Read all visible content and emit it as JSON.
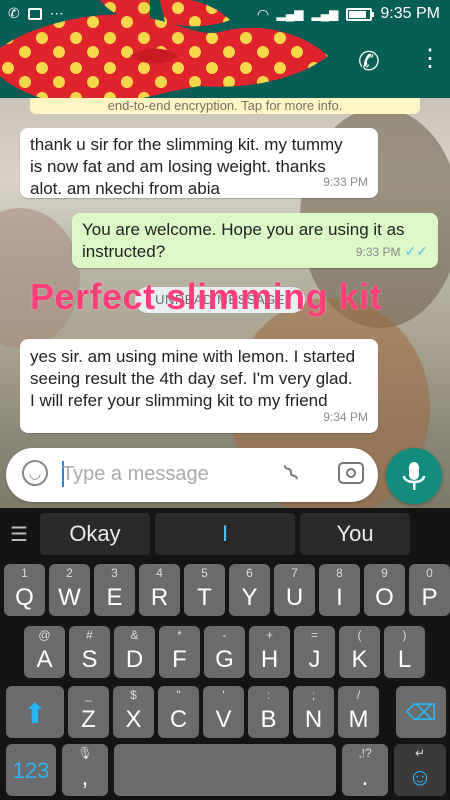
{
  "status_bar": {
    "time": "9:35 PM",
    "battery_level": 0.85
  },
  "chat": {
    "encryption_note": "end-to-end encryption. Tap for more info.",
    "messages": [
      {
        "direction": "in",
        "text_lines": [
          "thank u sir for the slimming kit. my tummy",
          "is now fat and am losing weight. thanks",
          "alot. am nkechi from abia"
        ],
        "time": "9:33 PM"
      },
      {
        "direction": "out",
        "text_lines": [
          "You are welcome. Hope you are using it as",
          "instructed?"
        ],
        "time": "9:33 PM",
        "ticks": "✓✓"
      },
      {
        "direction": "in",
        "text_lines": [
          "yes sir. am using mine with lemon. I started",
          "seeing result the 4th day sef. I'm very glad.",
          "I will refer your slimming kit to my friend"
        ],
        "time": "9:34 PM"
      }
    ],
    "unread_label": "UNREAD MESSAGE",
    "overlay_title": "Perfect slimming kit"
  },
  "input": {
    "placeholder": "Type a message"
  },
  "keyboard": {
    "suggestions": [
      "Okay",
      "I",
      "You"
    ],
    "row1": [
      {
        "main": "Q",
        "sub": "1"
      },
      {
        "main": "W",
        "sub": "2"
      },
      {
        "main": "E",
        "sub": "3"
      },
      {
        "main": "R",
        "sub": "4"
      },
      {
        "main": "T",
        "sub": "5"
      },
      {
        "main": "Y",
        "sub": "6"
      },
      {
        "main": "U",
        "sub": "7"
      },
      {
        "main": "I",
        "sub": "8"
      },
      {
        "main": "O",
        "sub": "9"
      },
      {
        "main": "P",
        "sub": "0"
      }
    ],
    "row2": [
      {
        "main": "A",
        "sub": "@"
      },
      {
        "main": "S",
        "sub": "#"
      },
      {
        "main": "D",
        "sub": "&"
      },
      {
        "main": "F",
        "sub": "*"
      },
      {
        "main": "G",
        "sub": "-"
      },
      {
        "main": "H",
        "sub": "+"
      },
      {
        "main": "J",
        "sub": "="
      },
      {
        "main": "K",
        "sub": "("
      },
      {
        "main": "L",
        "sub": ")"
      }
    ],
    "row3": [
      {
        "main": "Z",
        "sub": "_"
      },
      {
        "main": "X",
        "sub": "$"
      },
      {
        "main": "C",
        "sub": "\""
      },
      {
        "main": "V",
        "sub": "'"
      },
      {
        "main": "B",
        "sub": ":"
      },
      {
        "main": "N",
        "sub": ";"
      },
      {
        "main": "M",
        "sub": "/"
      }
    ],
    "numbers_key": "123",
    "comma_key": ",",
    "period_key": ".",
    "period_sub": ",!?"
  },
  "colors": {
    "header": "#075e54",
    "accent": "#128c7e",
    "overlay": "#ff3d7a"
  }
}
